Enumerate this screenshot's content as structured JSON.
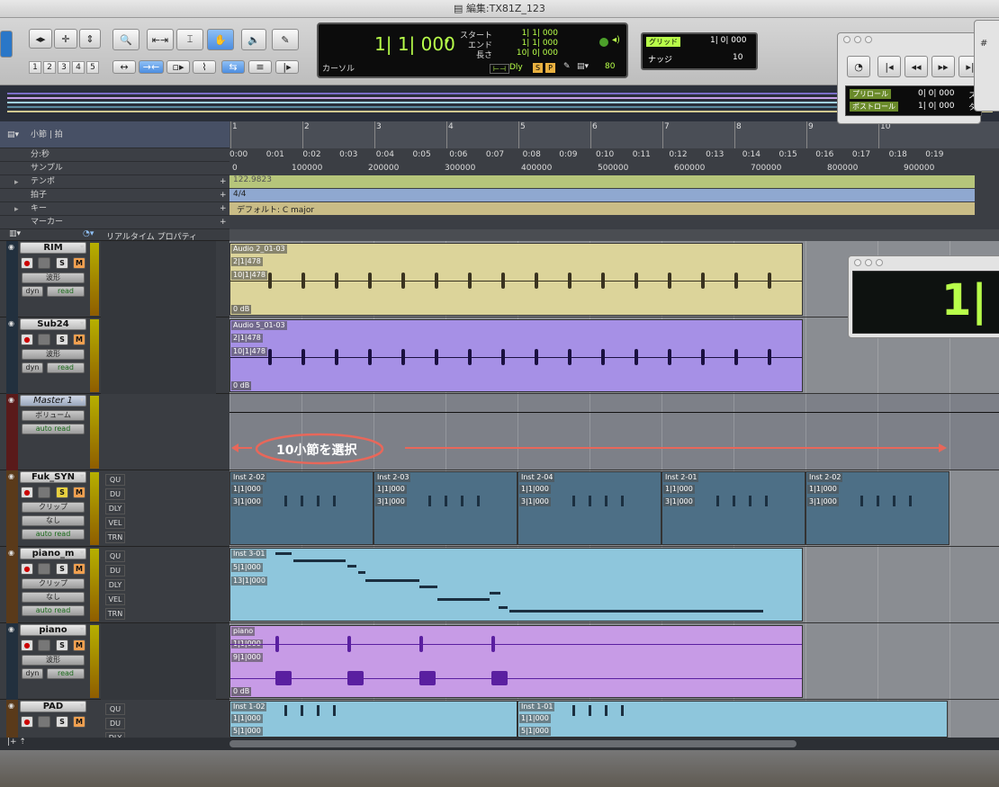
{
  "window": {
    "title": "編集:TX81Z_123"
  },
  "toolbar": {
    "zoom_presets": [
      "1",
      "2",
      "3",
      "4",
      "5"
    ],
    "counter": {
      "main": "1| 1| 000",
      "start_label": "スタート",
      "end_label": "エンド",
      "length_label": "長さ",
      "start": "1| 1| 000",
      "end": "1| 1| 000",
      "length": "10| 0| 000",
      "cursor_label": "カーソル",
      "dly_label": "Dly",
      "s_label": "S",
      "p_label": "P",
      "nudge_value_b": "80"
    },
    "grid": {
      "label": "グリッド",
      "value": "1| 0| 000",
      "nudge_label": "ナッジ",
      "nudge_value": "10"
    }
  },
  "transport": {
    "preroll_label": "プリロール",
    "preroll": "0| 0| 000",
    "postroll_label": "ポストロール",
    "postroll": "1| 0| 000",
    "st_label": "スタ"
  },
  "big_counter": {
    "value": "1|"
  },
  "ruler": {
    "rows": [
      "小節 | 拍",
      "分:秒",
      "サンプル",
      "テンポ",
      "拍子",
      "キー",
      "マーカー"
    ],
    "bars": [
      "1",
      "2",
      "3",
      "4",
      "5",
      "6",
      "7",
      "8",
      "9",
      "10"
    ],
    "times": [
      "0:00",
      "0:01",
      "0:02",
      "0:03",
      "0:04",
      "0:05",
      "0:06",
      "0:07",
      "0:08",
      "0:09",
      "0:10",
      "0:11",
      "0:12",
      "0:13",
      "0:14",
      "0:15",
      "0:16",
      "0:17",
      "0:18",
      "0:19"
    ],
    "samples": [
      "0",
      "100000",
      "200000",
      "300000",
      "400000",
      "500000",
      "600000",
      "700000",
      "800000",
      "900000"
    ],
    "tempo": "122.9823",
    "meter": "4/4",
    "key": "デフォルト: C major"
  },
  "realtime_header": "リアルタイム プロパティ",
  "annotation": {
    "text": "10小節を選択"
  },
  "tracks": [
    {
      "name": "RIM",
      "view": "波形",
      "mode": "read",
      "dyn": "dyn",
      "clip": "Audio 2_01-03",
      "l1": "2|1|478",
      "l2": "10|1|478",
      "gain": "0 dB"
    },
    {
      "name": "Sub24",
      "view": "波形",
      "mode": "read",
      "dyn": "dyn",
      "clip": "Audio 5_01-03",
      "l1": "2|1|478",
      "l2": "10|1|478",
      "gain": "0 dB"
    },
    {
      "name": "Master 1",
      "view": "ボリューム",
      "mode": "auto read"
    },
    {
      "name": "Fuk_SYN",
      "view": "クリップ",
      "sub": "なし",
      "mode": "auto read",
      "props": [
        "QU",
        "DU",
        "DLY",
        "VEL",
        "TRN"
      ],
      "clips": [
        {
          "name": "Inst 2-02",
          "l1": "1|1|000",
          "l2": "3|1|000"
        },
        {
          "name": "Inst 2-03",
          "l1": "1|1|000",
          "l2": "3|1|000"
        },
        {
          "name": "Inst 2-04",
          "l1": "1|1|000",
          "l2": "3|1|000"
        },
        {
          "name": "Inst 2-01",
          "l1": "1|1|000",
          "l2": "3|1|000"
        },
        {
          "name": "Inst 2-02",
          "l1": "1|1|000",
          "l2": "3|1|000"
        }
      ]
    },
    {
      "name": "piano_m",
      "view": "クリップ",
      "sub": "なし",
      "mode": "auto read",
      "props": [
        "QU",
        "DU",
        "DLY",
        "VEL",
        "TRN"
      ],
      "clip": "Inst 3-01",
      "l1": "5|1|000",
      "l2": "13|1|000"
    },
    {
      "name": "piano",
      "view": "波形",
      "mode": "read",
      "dyn": "dyn",
      "clip": "piano",
      "l1": "1|1|000",
      "l2": "9|1|000",
      "gain": "0 dB"
    },
    {
      "name": "PAD",
      "view": "クリップ",
      "props": [
        "QU",
        "DU",
        "DLY"
      ],
      "clips": [
        {
          "name": "Inst 1-02",
          "l1": "1|1|000",
          "l2": "5|1|000"
        },
        {
          "name": "Inst 1-01",
          "l1": "1|1|000",
          "l2": "5|1|000"
        }
      ]
    }
  ],
  "colors": {
    "rim": "#dcd49a",
    "sub": "#a690e6",
    "fuk": "#4d6f86",
    "piano_m": "#8ec6dc",
    "piano": "#c79be6",
    "pad": "#8ec6dc",
    "annotation": "#e8675a",
    "counter": "#b8ff4a"
  }
}
